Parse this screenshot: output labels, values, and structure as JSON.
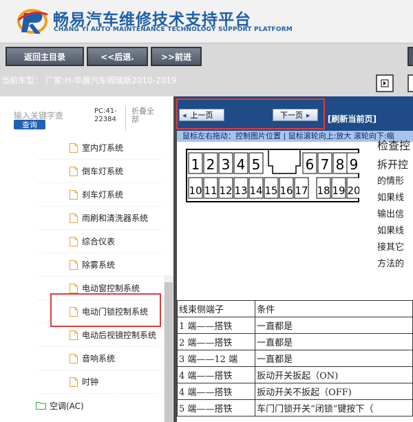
{
  "header": {
    "title": "畅易汽车维修技术支持平台",
    "subtitle": "CHANG YI AUTO MAINTENANCE TECHNOLOGY SUPPORT PLATFORM",
    "logo_icon": "cy-logo-icon"
  },
  "nav": {
    "home": "返回主目录",
    "back": "<<后退.",
    "forward": ">>前进"
  },
  "info": {
    "car_label": "当前车型：  厂家:H-华晨汽车阁瑞斯2010-2019"
  },
  "sidebar": {
    "search_placeholder": "输入关键字查",
    "search_button": "查询",
    "pc_code": "PC:41-22384",
    "collapse_all": "折叠全部",
    "items": [
      "室内灯系统",
      "倒车灯系统",
      "刹车灯系统",
      "雨刷和清洗器系统",
      "综合仪表",
      "除雾系统",
      "电动窗控制系统",
      "电动门锁控制系统",
      "电动后视镜控制系统",
      "音响系统",
      "时钟"
    ],
    "folder": "空调(AC)"
  },
  "viewer": {
    "prev_page": "上一页",
    "next_page": "下一页",
    "refresh": "[刷新当前页]",
    "hint": "鼠标左右拖动：控制图片位置 | 鼠标滚轮向上:放大  滚轮向下:缩"
  },
  "connector": {
    "top_pins": [
      "1",
      "2",
      "3",
      "4",
      "5",
      "6",
      "7",
      "8",
      "9"
    ],
    "bottom_pins": [
      "10",
      "11",
      "12",
      "13",
      "14",
      "15",
      "16",
      "17",
      "18",
      "19",
      "20"
    ]
  },
  "doc": {
    "lines": [
      "检查控",
      "拆开控",
      "的情形",
      "如果线",
      "输出信",
      "如果线",
      "接其它",
      "方法的"
    ],
    "table_header": [
      "线束侧端子",
      "条件"
    ],
    "table_rows": [
      [
        "1 端——搭铁",
        "一直都是"
      ],
      [
        "2 端——搭铁",
        "一直都是"
      ],
      [
        "3 端——12 端",
        "一直都是"
      ],
      [
        "4 端——搭铁",
        "扳动开关扳起（ON)"
      ],
      [
        "4 端——搭铁",
        "扳动开关不扳起（OFF)"
      ],
      [
        "5 端——搭铁",
        "车门门锁开关“闭锁”键按下（"
      ]
    ]
  },
  "colors": {
    "brand": "#1f5fa8",
    "toolbar": "#1f4b86",
    "highlight": "#e03a3a"
  }
}
